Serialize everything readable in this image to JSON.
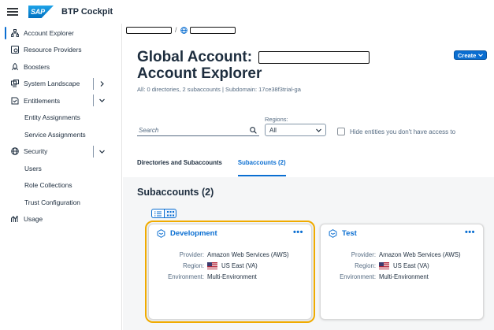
{
  "shell": {
    "app_title": "BTP Cockpit",
    "logo_text": "SAP"
  },
  "sidebar": {
    "items": [
      {
        "label": "Account Explorer"
      },
      {
        "label": "Resource Providers"
      },
      {
        "label": "Boosters"
      },
      {
        "label": "System Landscape"
      },
      {
        "label": "Entitlements"
      },
      {
        "label": "Entity Assignments"
      },
      {
        "label": "Service Assignments"
      },
      {
        "label": "Security"
      },
      {
        "label": "Users"
      },
      {
        "label": "Role Collections"
      },
      {
        "label": "Trust Configuration"
      },
      {
        "label": "Usage"
      }
    ]
  },
  "header": {
    "title_line1": "Global Account:",
    "title_line2": "Account Explorer",
    "subtitle": "All: 0 directories, 2 subaccounts | Subdomain: 17ce38f3trial-ga",
    "create_label": "Create"
  },
  "filters": {
    "search_placeholder": "Search",
    "regions_label": "Regions:",
    "regions_value": "All",
    "hide_label": "Hide entities you don't have access to"
  },
  "tabs": [
    {
      "label": "Directories and Subaccounts"
    },
    {
      "label": "Subaccounts (2)"
    }
  ],
  "section_title": "Subaccounts (2)",
  "cards": [
    {
      "name": "Development",
      "more": "•••",
      "provider_label": "Provider:",
      "provider": "Amazon Web Services (AWS)",
      "region_label": "Region:",
      "region": "US East (VA)",
      "environment_label": "Environment:",
      "environment": "Multi-Environment"
    },
    {
      "name": "Test",
      "more": "•••",
      "provider_label": "Provider:",
      "provider": "Amazon Web Services (AWS)",
      "region_label": "Region:",
      "region": "US East (VA)",
      "environment_label": "Environment:",
      "environment": "Multi-Environment"
    }
  ],
  "colors": {
    "accent": "#0a6ed1",
    "highlight": "#f0ab00",
    "background": "#f5f6f7"
  }
}
